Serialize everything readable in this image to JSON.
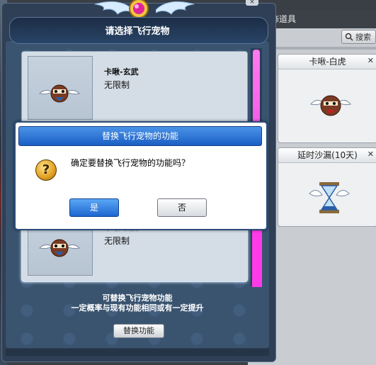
{
  "select_dialog": {
    "title": "请选择飞行宠物",
    "pets": [
      {
        "name": "卡啾-玄武",
        "limit": "无限制"
      },
      {
        "name": "",
        "limit": ""
      },
      {
        "name": "卡啾-玄武",
        "limit": "无限制"
      }
    ],
    "info_line1": "可替换飞行宠物功能",
    "info_line2": "一定概率与现有功能相同或有一定提升",
    "swap_button": "替换功能"
  },
  "confirm_dialog": {
    "title": "替换飞行宠物的功能",
    "message": "确定要替换飞行宠物的功能吗？",
    "yes": "是",
    "no": "否",
    "icon": "question-icon"
  },
  "shop_panel": {
    "header": "饰道具",
    "search": "搜索",
    "items": [
      {
        "name": "卡啾-白虎",
        "close": "✕"
      },
      {
        "name": "延时沙漏(10天)",
        "close": "✕"
      }
    ]
  },
  "colors": {
    "confirm_title": "#1b5fc5",
    "scrollbar": "#ff3be8",
    "panel": "#2f3f55"
  }
}
